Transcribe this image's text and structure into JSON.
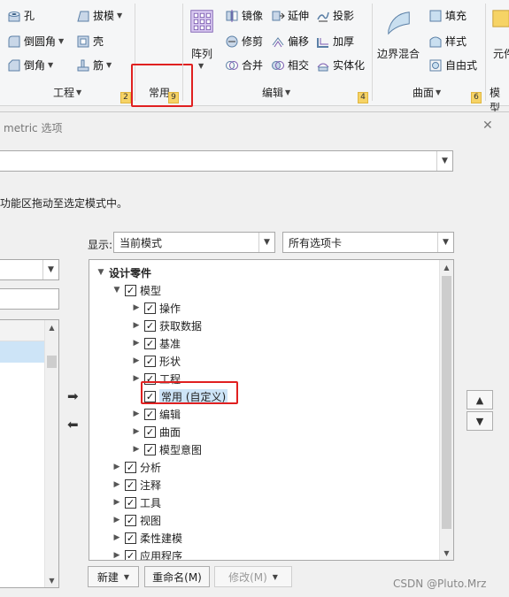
{
  "ribbon": {
    "tools_left": {
      "hole": "孔",
      "draft": "拔模",
      "round": "倒圆角",
      "shell": "壳",
      "chamfer": "倒角",
      "rib": "筋"
    },
    "pattern": "阵列",
    "edit_tools": {
      "mirror": "镜像",
      "extend": "延伸",
      "project": "投影",
      "trim": "修剪",
      "offset": "偏移",
      "thicken": "加厚",
      "merge": "合并",
      "intersect": "相交",
      "solidify": "实体化"
    },
    "surface_tools": {
      "boundary_blend": "边界混合",
      "fill": "填充",
      "style": "样式",
      "freestyle": "自由式"
    },
    "partial_right": "元件",
    "groups": {
      "engineering": "工程",
      "common": "常用",
      "editing": "编辑",
      "surfaces": "曲面",
      "model_intent": "模型"
    },
    "badges": {
      "engineering": "2",
      "common": "9",
      "editing": "4",
      "surfaces": "6"
    },
    "accent": "#e02020"
  },
  "dialog": {
    "title": "metric 选项",
    "hint": "功能区拖动至选定模式中。",
    "show_label": "显示:",
    "show_mode": "当前模式",
    "tabs_filter": "所有选项卡",
    "tree": {
      "root": "设计零件",
      "model": "模型",
      "model_children": [
        "操作",
        "获取数据",
        "基准",
        "形状",
        "工程",
        "常用 (自定义)",
        "编辑",
        "曲面",
        "模型意图"
      ],
      "siblings": [
        "分析",
        "注释",
        "工具",
        "视图",
        "柔性建模",
        "应用程序"
      ]
    },
    "buttons": {
      "new": "新建",
      "rename": "重命名(M)",
      "modify": "修改(M)"
    }
  },
  "watermark": "CSDN @Pluto.Mrz"
}
